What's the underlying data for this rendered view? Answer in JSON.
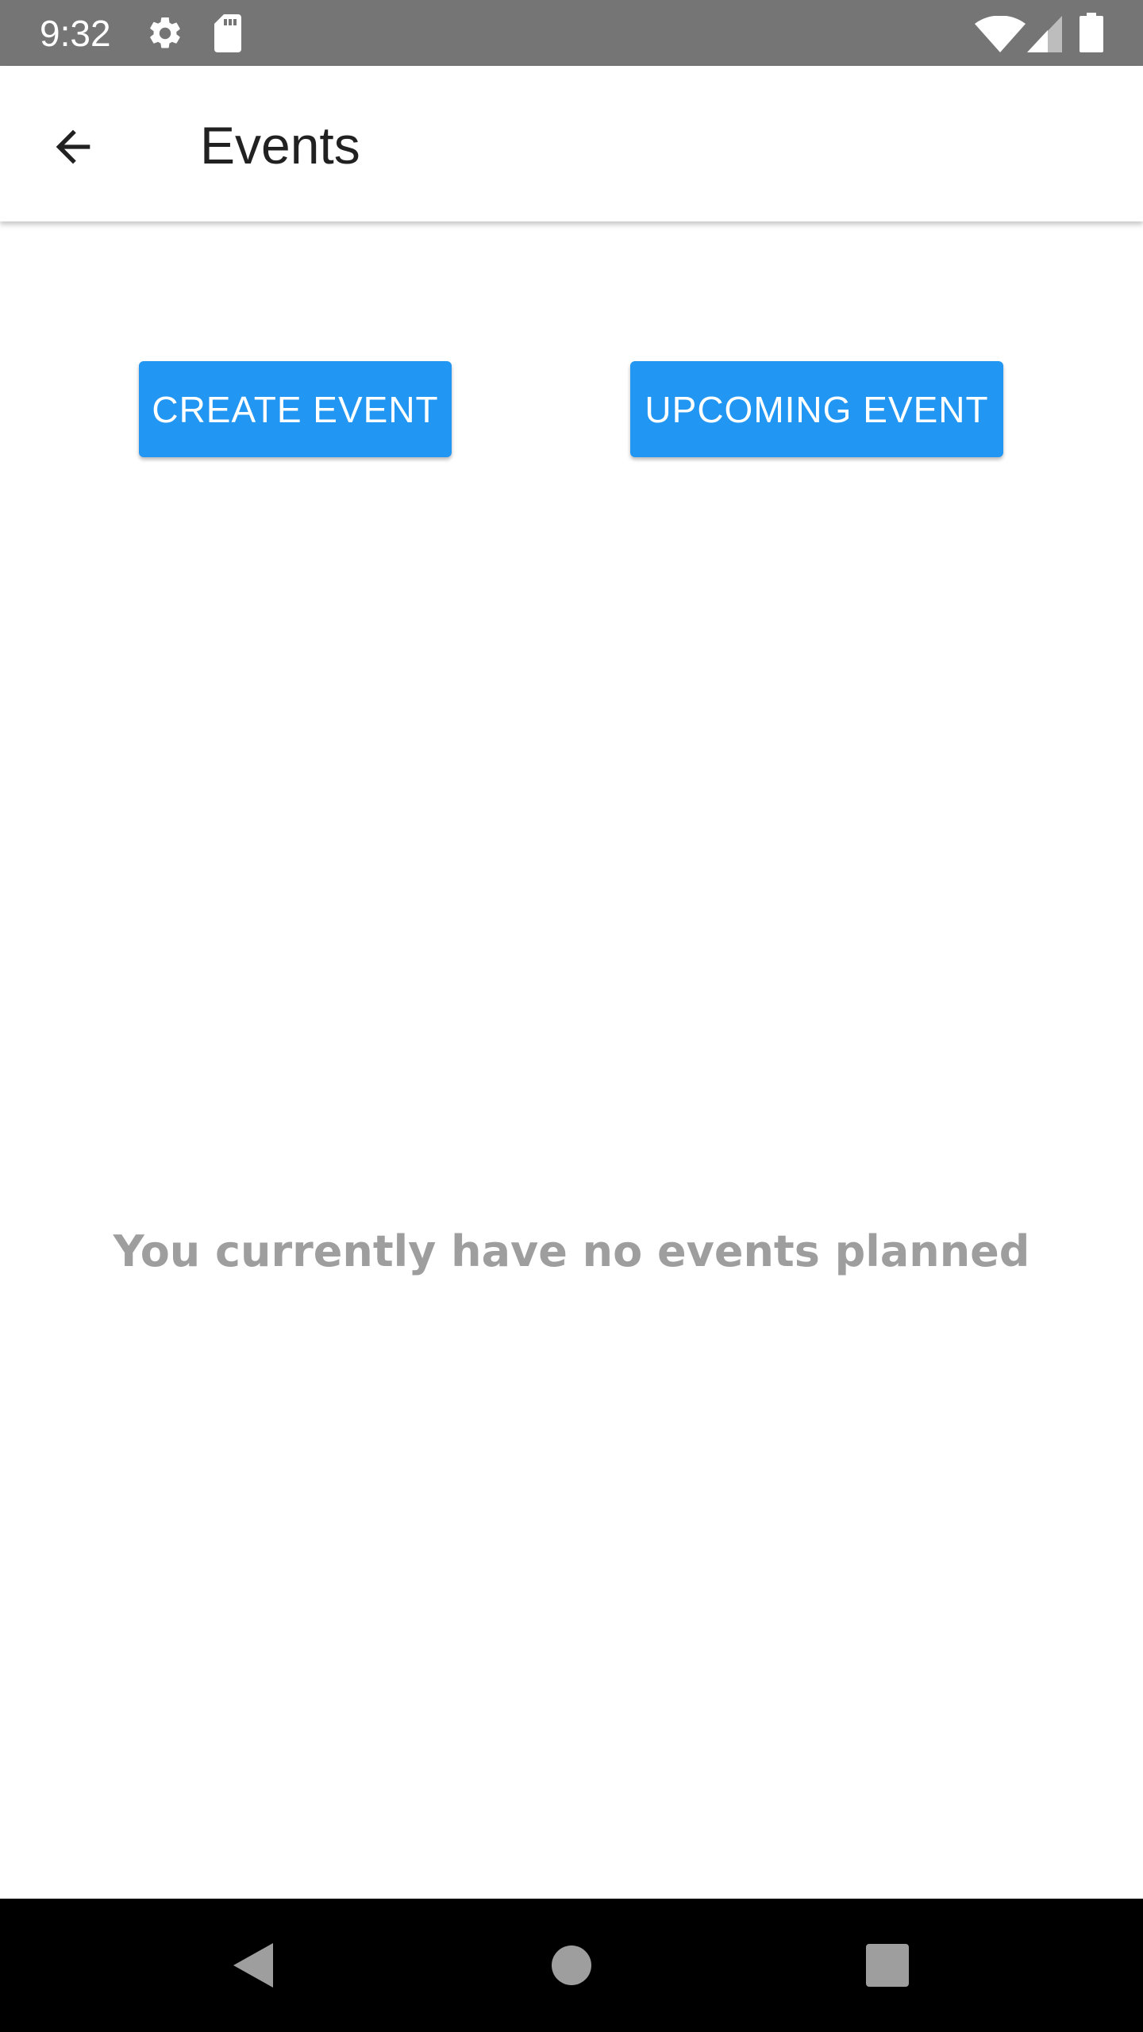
{
  "status_bar": {
    "time": "9:32",
    "icons": [
      "gear-icon",
      "sd-card-icon",
      "wifi-icon",
      "signal-icon",
      "battery-icon"
    ],
    "background": "#757575"
  },
  "app_bar": {
    "back_icon": "arrow-back-icon",
    "title": "Events"
  },
  "actions": {
    "create_label": "CREATE EVENT",
    "upcoming_label": "UPCOMING EVENT",
    "button_color": "#2196f3"
  },
  "empty_state": {
    "message": "You currently have no events planned"
  },
  "nav_bar": {
    "icons": [
      "nav-back-icon",
      "nav-home-icon",
      "nav-recents-icon"
    ]
  }
}
